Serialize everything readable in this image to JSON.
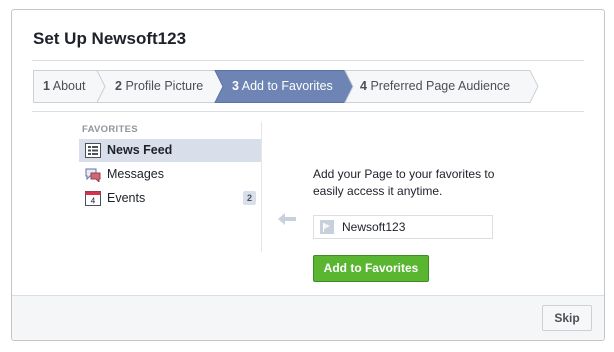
{
  "dialog": {
    "title": "Set Up Newsoft123"
  },
  "steps": [
    {
      "number": "1",
      "label": "About",
      "active": false
    },
    {
      "number": "2",
      "label": "Profile Picture",
      "active": false
    },
    {
      "number": "3",
      "label": "Add to Favorites",
      "active": true
    },
    {
      "number": "4",
      "label": "Preferred Page Audience",
      "active": false
    }
  ],
  "favorites": {
    "heading": "FAVORITES",
    "items": [
      {
        "label": "News Feed",
        "icon": "news-feed-icon",
        "selected": true
      },
      {
        "label": "Messages",
        "icon": "messages-icon",
        "selected": false
      },
      {
        "label": "Events",
        "icon": "calendar-icon",
        "calendar_day": "4",
        "badge": "2",
        "selected": false
      }
    ]
  },
  "main": {
    "description": "Add your Page to your favorites to easily access it anytime.",
    "page_name": "Newsoft123",
    "add_button_label": "Add to Favorites"
  },
  "footer": {
    "skip_label": "Skip"
  },
  "colors": {
    "active_step": "#6d84b4",
    "add_button": "#5ab531",
    "selected_item": "#d8dfea"
  }
}
